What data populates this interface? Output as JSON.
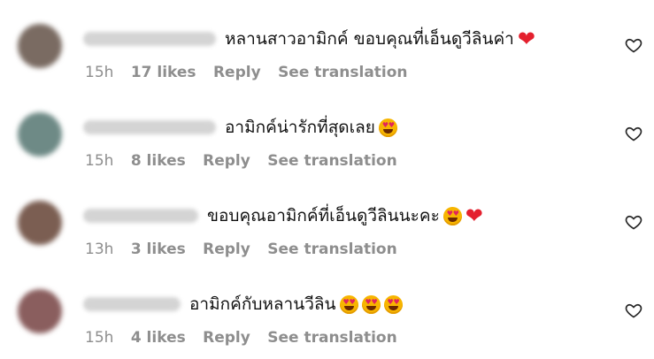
{
  "comments": [
    {
      "text": "หลานสาวอามิกค์ ขอบคุณที่เอ็นดูวีลินค่า",
      "emojis": [
        "heart"
      ],
      "time": "15h",
      "likes": "17 likes",
      "reply": "Reply",
      "translate": "See translation",
      "avatar_color": "#7a6b62",
      "username_width_hint": "long"
    },
    {
      "text": "อามิกค์น่ารักที่สุดเลย",
      "emojis": [
        "heart-eyes"
      ],
      "time": "15h",
      "likes": "8 likes",
      "reply": "Reply",
      "translate": "See translation",
      "avatar_color": "#6e8a86",
      "username_width_hint": "long"
    },
    {
      "text": "ขอบคุณอามิกค์ที่เอ็นดูวีลินนะคะ",
      "emojis": [
        "heart-eyes",
        "heart"
      ],
      "time": "13h",
      "likes": "3 likes",
      "reply": "Reply",
      "translate": "See translation",
      "avatar_color": "#7b5e52",
      "username_width_hint": "medium"
    },
    {
      "text": "อามิกค์กับหลานวีลิน",
      "emojis": [
        "heart-eyes",
        "heart-eyes",
        "heart-eyes"
      ],
      "time": "15h",
      "likes": "4 likes",
      "reply": "Reply",
      "translate": "See translation",
      "avatar_color": "#8a5e5e",
      "username_width_hint": "short"
    }
  ],
  "icons": {
    "like": "heart-outline-icon"
  },
  "colors": {
    "text": "#111111",
    "meta": "#8e8e8e",
    "heart": "#e4202e"
  }
}
